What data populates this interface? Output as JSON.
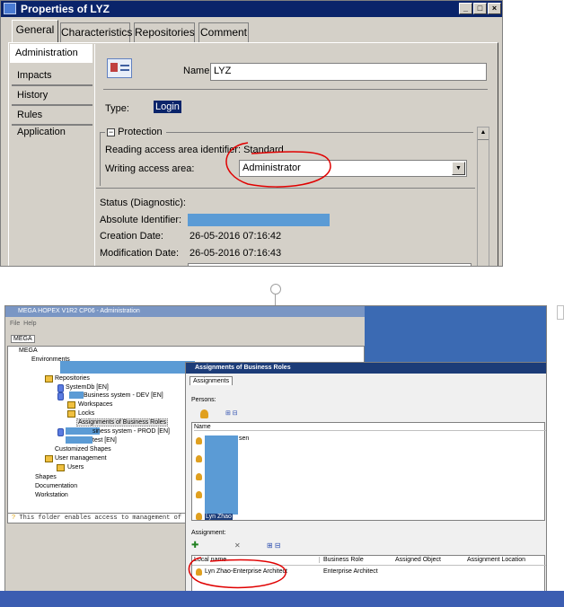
{
  "dialog": {
    "title": "Properties of LYZ",
    "tabs": [
      "General",
      "Characteristics",
      "Repositories",
      "Comment"
    ],
    "side": [
      "Administration",
      "Impacts",
      "History",
      "Rules Application"
    ],
    "name_label": "Name",
    "name_value": "LYZ",
    "type_label": "Type:",
    "type_value": "Login",
    "protection_label": "Protection",
    "reading_label": "Reading access area identifier: Standard",
    "writing_label": "Writing access area:",
    "writing_value": "Administrator",
    "status_label": "Status (Diagnostic):",
    "absid_label": "Absolute Identifier:",
    "creation_label": "Creation Date:",
    "creation_value": "26-05-2016 07:16:42",
    "mod_label": "Modification Date:",
    "mod_value": "26-05-2016 07:16:43"
  },
  "app": {
    "title": "MEGA HOPEX V1R2 CP06 - Administration",
    "menu": [
      "File",
      "Help"
    ],
    "tab": "MEGA",
    "root": "MEGA",
    "env": "Environments",
    "tree": [
      "Repositories",
      "SystemDb [EN]",
      "Business system - DEV [EN]",
      "Workspaces",
      "Locks",
      "Assignments of Business Roles",
      "siness system - PROD [EN]",
      "test [EN]",
      "Customized Shapes",
      "User management",
      "Users",
      "Shapes",
      "Documentation",
      "Workstation"
    ],
    "status": "This folder enables access to management of as"
  },
  "roles": {
    "title": "Assignments of Business Roles",
    "tab": "Assignments",
    "persons_label": "Persons:",
    "name_col": "Name",
    "partial_name": "sen",
    "selected_person": "Lyn Zhao",
    "assign_label": "Assignment:",
    "cols": [
      "Local name",
      "Business Role",
      "Assigned Object",
      "Assignment Location"
    ],
    "row": [
      "Lyn Zhao-Enterprise Architect",
      "Enterprise Architect"
    ]
  }
}
